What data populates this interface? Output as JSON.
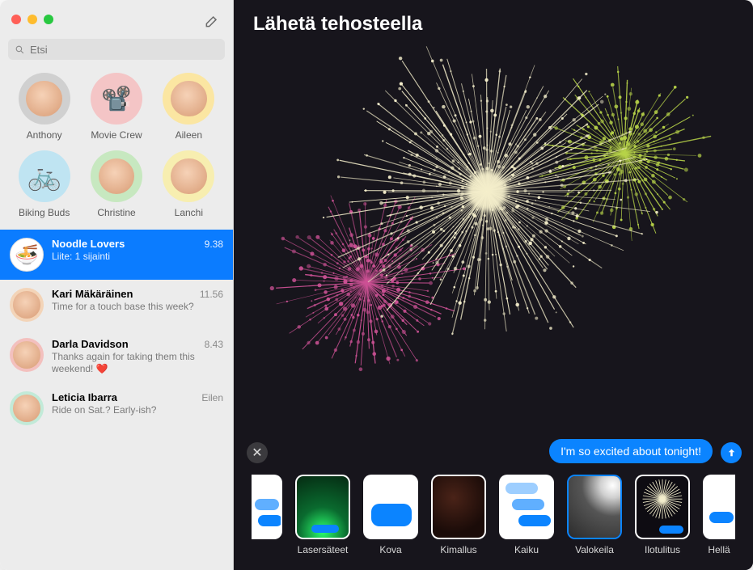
{
  "window": {
    "search_placeholder": "Etsi"
  },
  "pinned": [
    {
      "label": "Anthony",
      "bg": "bg-grey"
    },
    {
      "label": "Movie Crew",
      "bg": "bg-pink",
      "icon": "projector"
    },
    {
      "label": "Aileen",
      "bg": "bg-yel"
    },
    {
      "label": "Biking Buds",
      "bg": "bg-blue",
      "icon": "bike"
    },
    {
      "label": "Christine",
      "bg": "bg-grn"
    },
    {
      "label": "Lanchi",
      "bg": "bg-ylw2"
    }
  ],
  "conversations": [
    {
      "name": "Noodle Lovers",
      "preview": "Liite:  1 sijainti",
      "time": "9.38",
      "selected": true,
      "bg": "bg-wht",
      "icon": "noodles"
    },
    {
      "name": "Kari Mäkäräinen",
      "preview": "Time for a touch base this week?",
      "time": "11.56",
      "selected": false,
      "bg": "bg-or"
    },
    {
      "name": "Darla Davidson",
      "preview": "Thanks again for taking them this weekend! ❤️",
      "time": "8.43",
      "selected": false,
      "bg": "bg-red"
    },
    {
      "name": "Leticia Ibarra",
      "preview": "Ride on Sat.? Early-ish?",
      "time": "Eilen",
      "selected": false,
      "bg": "bg-mint"
    }
  ],
  "effect": {
    "title": "Lähetä tehosteella",
    "message": "I'm so excited about tonight!",
    "selected_index": 5,
    "options": [
      {
        "label": "",
        "type": "echo-cut"
      },
      {
        "label": "Lasersäteet",
        "type": "lasers"
      },
      {
        "label": "Kova",
        "type": "slam"
      },
      {
        "label": "Kimallus",
        "type": "sparkle"
      },
      {
        "label": "Kaiku",
        "type": "echo"
      },
      {
        "label": "Valokeila",
        "type": "spotlight"
      },
      {
        "label": "Ilotulitus",
        "type": "fireworks"
      },
      {
        "label": "Hellä",
        "type": "gentle"
      }
    ]
  }
}
